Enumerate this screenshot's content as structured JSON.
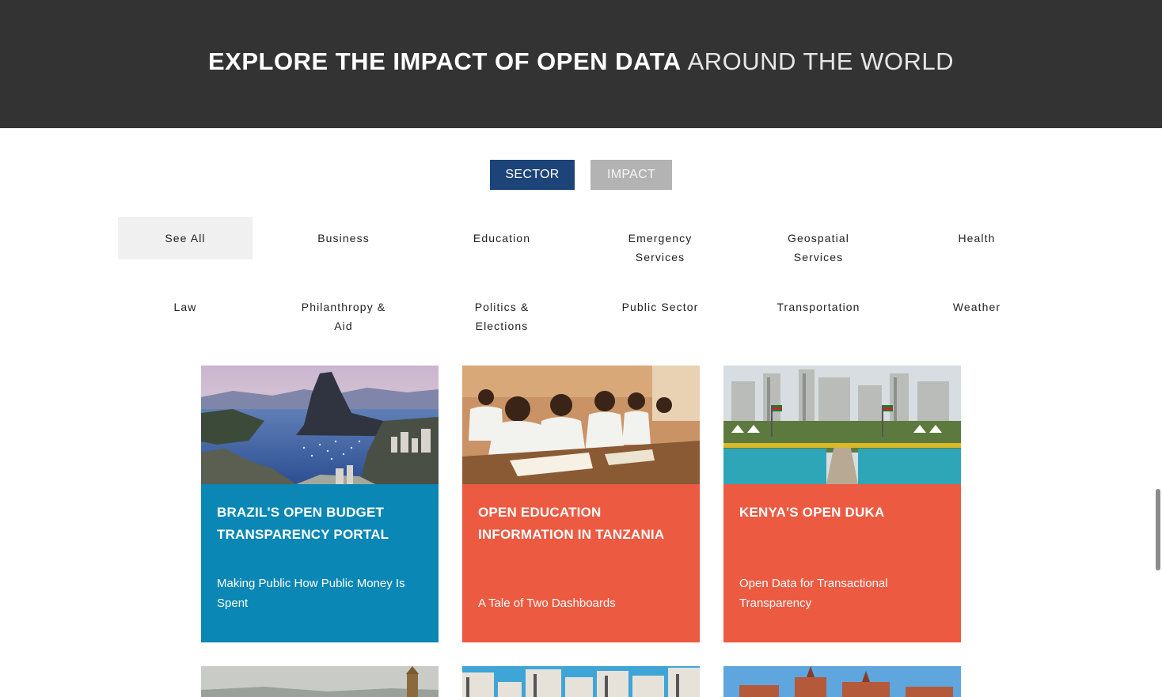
{
  "hero": {
    "title_bold": "EXPLORE THE IMPACT OF OPEN DATA",
    "title_light": "AROUND THE WORLD"
  },
  "toggle": {
    "sector_label": "SECTOR",
    "impact_label": "IMPACT",
    "active": "sector",
    "active_color": "#1c4478",
    "inactive_color": "#b3b3b3"
  },
  "filters": {
    "items": [
      {
        "label": "See All",
        "selected": true
      },
      {
        "label": "Business"
      },
      {
        "label": "Education"
      },
      {
        "label": "Emergency Services"
      },
      {
        "label": "Geospatial Services"
      },
      {
        "label": "Health"
      },
      {
        "label": "Law"
      },
      {
        "label": "Philanthropy & Aid"
      },
      {
        "label": "Politics & Elections"
      },
      {
        "label": "Public Sector"
      },
      {
        "label": "Transportation"
      },
      {
        "label": "Weather"
      }
    ]
  },
  "cards": [
    {
      "title": "BRAZIL'S OPEN BUDGET TRANSPARENCY PORTAL",
      "subtitle": "Making Public How Public Money Is Spent",
      "color": "#0a87b4",
      "image": "rio-de-janeiro-bay-photo"
    },
    {
      "title": "OPEN EDUCATION INFORMATION IN TANZANIA",
      "subtitle": "A Tale of Two Dashboards",
      "color": "#ec5a41",
      "image": "classroom-students-photo"
    },
    {
      "title": "KENYA'S OPEN DUKA",
      "subtitle": "Open Data for Transactional Transparency",
      "color": "#ec5a41",
      "image": "nairobi-city-square-photo"
    }
  ],
  "teasers": [
    {
      "image": "cathedral-skyline-photo"
    },
    {
      "image": "city-buildings-photo"
    },
    {
      "image": "castle-buildings-photo"
    }
  ]
}
